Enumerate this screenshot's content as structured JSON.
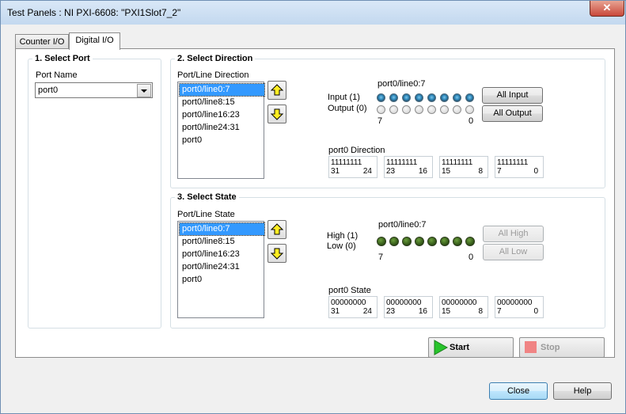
{
  "window": {
    "title": "Test Panels : NI PXI-6608: \"PXI1Slot7_2\"",
    "close_glyph": "✕"
  },
  "tabs": [
    {
      "label": "Counter I/O"
    },
    {
      "label": "Digital I/O"
    }
  ],
  "select_port": {
    "title": "1. Select Port",
    "port_name_label": "Port Name",
    "port_name_value": "port0"
  },
  "select_direction": {
    "title": "2. Select Direction",
    "list_label": "Port/Line Direction",
    "items": [
      "port0/line0:7",
      "port0/line8:15",
      "port0/line16:23",
      "port0/line24:31",
      "port0"
    ],
    "selected_index": 0,
    "lines_label": "port0/line0:7",
    "input_label": "Input (1)",
    "output_label": "Output (0)",
    "bit_hi": "7",
    "bit_lo": "0",
    "all_input_label": "All Input",
    "all_output_label": "All Output",
    "register_label": "port0 Direction",
    "registers": [
      {
        "value": "11111111",
        "hi": "31",
        "lo": "24"
      },
      {
        "value": "11111111",
        "hi": "23",
        "lo": "16"
      },
      {
        "value": "11111111",
        "hi": "15",
        "lo": "8"
      },
      {
        "value": "11111111",
        "hi": "7",
        "lo": "0"
      }
    ]
  },
  "select_state": {
    "title": "3. Select State",
    "list_label": "Port/Line State",
    "items": [
      "port0/line0:7",
      "port0/line8:15",
      "port0/line16:23",
      "port0/line24:31",
      "port0"
    ],
    "selected_index": 0,
    "lines_label": "port0/line0:7",
    "high_label": "High (1)",
    "low_label": "Low (0)",
    "bit_hi": "7",
    "bit_lo": "0",
    "all_high_label": "All High",
    "all_low_label": "All Low",
    "register_label": "port0 State",
    "registers": [
      {
        "value": "00000000",
        "hi": "31",
        "lo": "24"
      },
      {
        "value": "00000000",
        "hi": "23",
        "lo": "16"
      },
      {
        "value": "00000000",
        "hi": "15",
        "lo": "8"
      },
      {
        "value": "00000000",
        "hi": "7",
        "lo": "0"
      }
    ]
  },
  "start_label": "Start",
  "stop_label": "Stop",
  "close_label": "Close",
  "help_label": "Help",
  "colors": {
    "selection": "#3399ff",
    "start_icon": "#27c42b",
    "stop_icon": "#f08484",
    "arrow_icon": "#ffee22"
  }
}
